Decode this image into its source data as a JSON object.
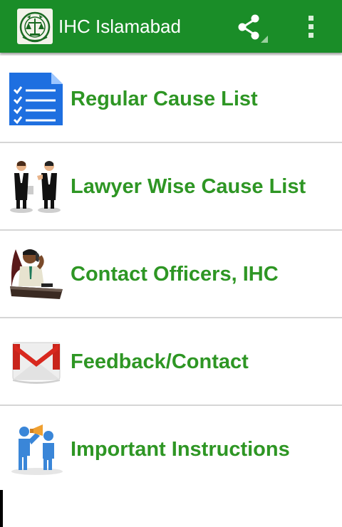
{
  "app": {
    "title": "IHC Islamabad",
    "logo_icon": "ihc-emblem-logo",
    "bar_color": "#1a8d28"
  },
  "actions": {
    "share_icon": "share-icon",
    "overflow_icon": "overflow-menu-icon"
  },
  "menu": {
    "accent_color": "#2e9624",
    "items": [
      {
        "label": "Regular Cause List",
        "icon": "document-checklist-icon"
      },
      {
        "label": "Lawyer Wise Cause List",
        "icon": "lawyers-icon"
      },
      {
        "label": "Contact Officers, IHC",
        "icon": "officer-on-phone-icon"
      },
      {
        "label": "Feedback/Contact",
        "icon": "gmail-envelope-icon"
      },
      {
        "label": "Important Instructions",
        "icon": "megaphone-people-icon"
      }
    ]
  }
}
